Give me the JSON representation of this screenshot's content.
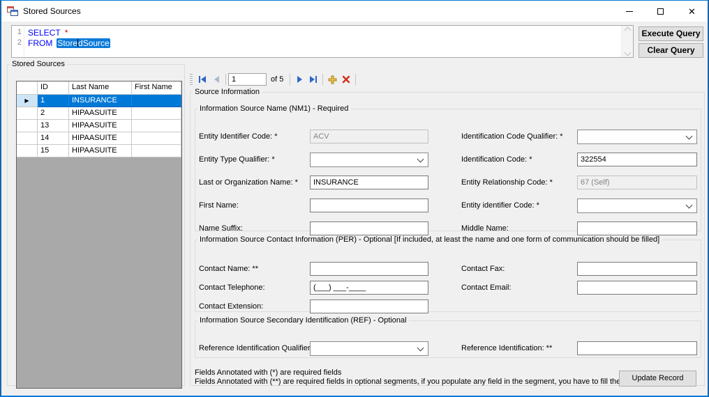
{
  "window": {
    "title": "Stored Sources",
    "icons": {
      "app_icon": "winforms-overlapping-windows",
      "minimize": "horizontal-bar",
      "maximize": "hollow-square",
      "close": "✕"
    }
  },
  "colors": {
    "accent": "#0078d7",
    "selection_blue": "#0078d7",
    "keyword_blue": "#0000ff",
    "operator_red": "#cc0000",
    "nav_arrow_blue": "#2e66c9",
    "add_gold": "#e2a93d",
    "delete_red": "#d12f19"
  },
  "query_editor": {
    "line_numbers": [
      "1",
      "2"
    ],
    "line1": {
      "keyword": "SELECT",
      "operator": "*"
    },
    "line2": {
      "keyword": "FROM",
      "selected_before_caret": "Store",
      "selected_after_caret": "dSource"
    }
  },
  "query_buttons": {
    "execute": "Execute Query",
    "clear": "Clear Query"
  },
  "stored_sources": {
    "group_label": "Stored Sources",
    "grid": {
      "columns": [
        "ID",
        "Last Name",
        "First Name"
      ],
      "selected_row_index": 0,
      "rows": [
        {
          "id": "1",
          "last_name": "INSURANCE",
          "first_name": ""
        },
        {
          "id": "2",
          "last_name": "HIPAASUITE",
          "first_name": ""
        },
        {
          "id": "13",
          "last_name": "HIPAASUITE",
          "first_name": ""
        },
        {
          "id": "14",
          "last_name": "HIPAASUITE",
          "first_name": ""
        },
        {
          "id": "15",
          "last_name": "HIPAASUITE",
          "first_name": ""
        }
      ]
    }
  },
  "record_navigator": {
    "position_value": "1",
    "count_label": "of 5"
  },
  "source_information": {
    "group_label": "Source Information",
    "nm1": {
      "group_label": "Information Source Name (NM1) - Required",
      "entity_identifier_code": {
        "label": "Entity Identifier Code: *",
        "value": "ACV"
      },
      "identification_code_qualifier": {
        "label": "Identification Code Qualifier: *",
        "value": ""
      },
      "entity_type_qualifier": {
        "label": "Entity Type Qualifier: *",
        "value": ""
      },
      "identification_code": {
        "label": "Identification Code: *",
        "value": "322554"
      },
      "last_or_organization_name": {
        "label": "Last or Organization Name: *",
        "value": "INSURANCE"
      },
      "entity_relationship_code": {
        "label": "Entity Relationship Code: *",
        "value": "67 (Self)"
      },
      "first_name": {
        "label": "First Name:",
        "value": ""
      },
      "entity_identifier_code_2": {
        "label": "Entity identifier Code: *",
        "value": ""
      },
      "name_suffix": {
        "label": "Name Suffix:",
        "value": ""
      },
      "middle_name": {
        "label": "Middle Name:",
        "value": ""
      }
    },
    "per": {
      "group_label": "Information Source Contact Information (PER) - Optional [If included, at least the name and one form of communication should be filled]",
      "contact_name": {
        "label": "Contact Name: **",
        "value": ""
      },
      "contact_fax": {
        "label": "Contact Fax:",
        "value": ""
      },
      "contact_telephone": {
        "label": "Contact Telephone:",
        "value": "(___) ___-____"
      },
      "contact_email": {
        "label": "Contact Email:",
        "value": ""
      },
      "contact_extension": {
        "label": "Contact Extension:",
        "value": ""
      }
    },
    "ref": {
      "group_label": "Information Source Secondary Identification (REF) - Optional",
      "reference_identification_qualifier": {
        "label": "Reference Identification Qualifier: **",
        "value": ""
      },
      "reference_identification": {
        "label": "Reference Identification: **",
        "value": ""
      }
    },
    "notes": {
      "line1": "Fields Annotated with (*) are required fields",
      "line2": "Fields Annotated with (**) are required fields in optional segments, if you populate any field in the segment, you have to fill them too."
    },
    "update_button": "Update Record"
  }
}
